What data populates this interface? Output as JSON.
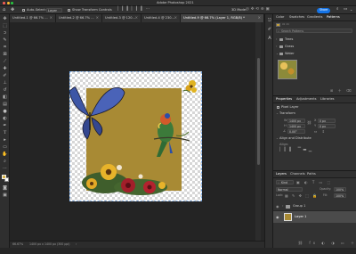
{
  "app": {
    "title": "Adobe Photoshop 2021"
  },
  "window": {
    "traffic_light_colors": [
      "#ff5f56",
      "#ffbd2e",
      "#27c93f"
    ]
  },
  "options_bar": {
    "auto_select_label": "Auto-Select:",
    "auto_select_value": "Layer",
    "show_transform_label": "Show Transform Controls",
    "mode_3d_label": "3D Mode:",
    "share_label": "Share"
  },
  "tabs": [
    {
      "label": "Untitled-1 @ 66.7% ..."
    },
    {
      "label": "Untitled-2 @ 66.7% ..."
    },
    {
      "label": "Untitled-3 @ 120..."
    },
    {
      "label": "Untitled-4 @ 230..."
    },
    {
      "label": "Untitled-9 @ 66.7% (Layer 1, RGB/8) *"
    }
  ],
  "status_bar": {
    "zoom": "66.67%",
    "doc_info": "1400 px x 1400 px (300 ppi)"
  },
  "top_panel": {
    "tabs": [
      "Color",
      "Swatches",
      "Gradients",
      "Patterns"
    ],
    "active_tab": "Patterns",
    "search_placeholder": "Search Patterns",
    "groups": [
      {
        "label": "Trees"
      },
      {
        "label": "Grass"
      },
      {
        "label": "Water"
      }
    ]
  },
  "properties_panel": {
    "tabs": [
      "Properties",
      "Adjustments",
      "Libraries"
    ],
    "active_tab": "Properties",
    "layer_type": "Pixel Layer",
    "transform_label": "Transform",
    "w_label": "W",
    "h_label": "H",
    "x_label": "X",
    "y_label": "Y",
    "w_value": "1400 px",
    "h_value": "1400 px",
    "x_value": "0 px",
    "y_value": "0 px",
    "angle_value": "0.00°",
    "align_label": "Align and Distribute",
    "align_sub": "Align:"
  },
  "layers_panel": {
    "tabs": [
      "Layers",
      "Channels",
      "Paths"
    ],
    "active_tab": "Layers",
    "kind_label": "Kind",
    "blend_mode": "Normal",
    "opacity_label": "Opacity:",
    "opacity_value": "100%",
    "lock_label": "Lock:",
    "fill_label": "Fill:",
    "fill_value": "100%",
    "layers": [
      {
        "name": "Group 1",
        "kind": "folder"
      },
      {
        "name": "Layer 1",
        "kind": "pixel",
        "selected": true
      }
    ]
  },
  "colors": {
    "accent": "#1473e6",
    "canvas_fill": "#a88a34",
    "panel_bg": "#323232",
    "app_bg": "#262626"
  }
}
